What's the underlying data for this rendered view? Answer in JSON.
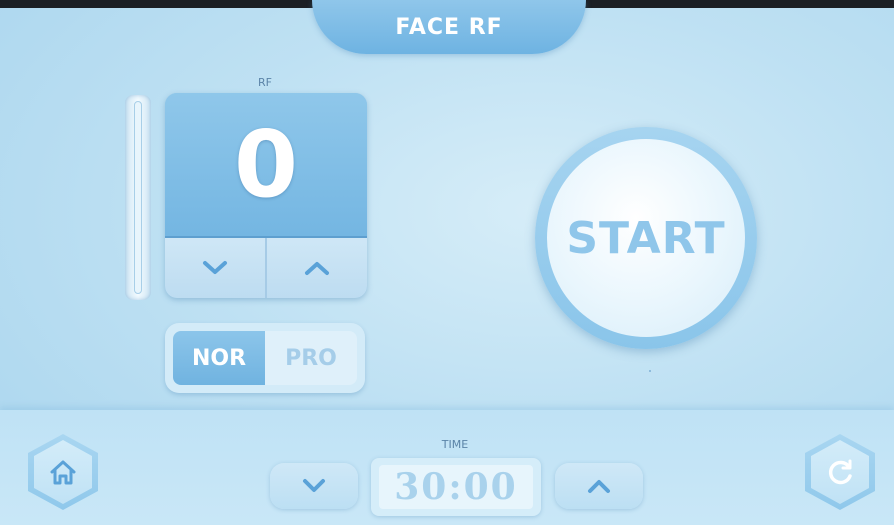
{
  "header": {
    "title": "FACE RF"
  },
  "rf": {
    "label": "RF",
    "value": "0",
    "down_icon": "chevron-down-icon",
    "up_icon": "chevron-up-icon"
  },
  "mode": {
    "options": [
      "NOR",
      "PRO"
    ],
    "selected": "NOR"
  },
  "start": {
    "label": "START"
  },
  "time": {
    "label": "TIME",
    "value": "30:00",
    "down_icon": "chevron-down-icon",
    "up_icon": "chevron-up-icon"
  },
  "footer": {
    "home_icon": "home-icon",
    "refresh_icon": "refresh-icon"
  },
  "colors": {
    "accent": "#74b6e2",
    "background": "#bfe1f3",
    "button_text": "#5aa2d8"
  }
}
